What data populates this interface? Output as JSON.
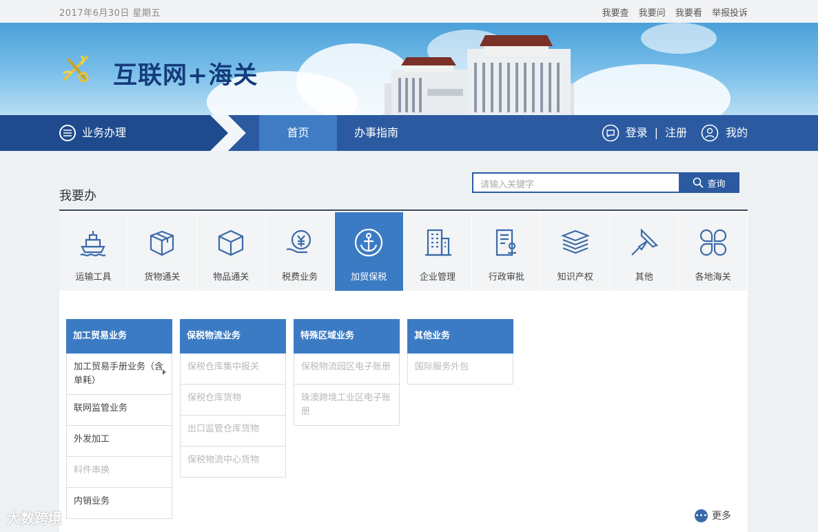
{
  "topbar": {
    "date": "2017年6月30日  星期五",
    "links": [
      "我要查",
      "我要问",
      "我要看",
      "举报投诉"
    ]
  },
  "banner": {
    "title": "互联网+海关"
  },
  "nav": {
    "menu_label": "业务办理",
    "home": "首页",
    "guide": "办事指南",
    "login": "登录",
    "separator": "|",
    "register": "注册",
    "mine": "我的"
  },
  "section": {
    "title": "我要办",
    "search_placeholder": "请输入关键字",
    "search_button": "查询"
  },
  "tiles": [
    {
      "label": "运输工具",
      "icon": "ship-icon"
    },
    {
      "label": "货物通关",
      "icon": "package-icon"
    },
    {
      "label": "物品通关",
      "icon": "box-icon"
    },
    {
      "label": "税费业务",
      "icon": "yuan-hand-icon"
    },
    {
      "label": "加贸保税",
      "icon": "anchor-icon",
      "active": true
    },
    {
      "label": "企业管理",
      "icon": "building-icon"
    },
    {
      "label": "行政审批",
      "icon": "document-stamp-icon"
    },
    {
      "label": "知识产权",
      "icon": "books-icon"
    },
    {
      "label": "其他",
      "icon": "pin-icon"
    },
    {
      "label": "各地海关",
      "icon": "clover-icon"
    }
  ],
  "columns": [
    {
      "header": "加工贸易业务",
      "items": [
        {
          "label": "加工贸易手册业务（含单耗）",
          "dim": false,
          "arrow": true
        },
        {
          "label": "联网监管业务",
          "dim": false
        },
        {
          "label": "外发加工",
          "dim": false
        },
        {
          "label": "料件串换",
          "dim": true
        },
        {
          "label": "内销业务",
          "dim": false
        }
      ]
    },
    {
      "header": "保税物流业务",
      "items": [
        {
          "label": "保税仓库集中报关",
          "dim": true
        },
        {
          "label": "保税仓库货物",
          "dim": true
        },
        {
          "label": "出口监管仓库货物",
          "dim": true
        },
        {
          "label": "保税物流中心货物",
          "dim": true
        }
      ]
    },
    {
      "header": "特殊区域业务",
      "items": [
        {
          "label": "保税物流园区电子账册",
          "dim": true
        },
        {
          "label": "珠澳跨境工业区电子账册",
          "dim": true
        }
      ]
    },
    {
      "header": "其他业务",
      "items": [
        {
          "label": "国际服务外包",
          "dim": true
        }
      ]
    }
  ],
  "more": "更多",
  "watermark": "大数跨境",
  "colors": {
    "primary": "#2b5aa0",
    "active": "#3b7bc4",
    "title": "#143b7a"
  }
}
